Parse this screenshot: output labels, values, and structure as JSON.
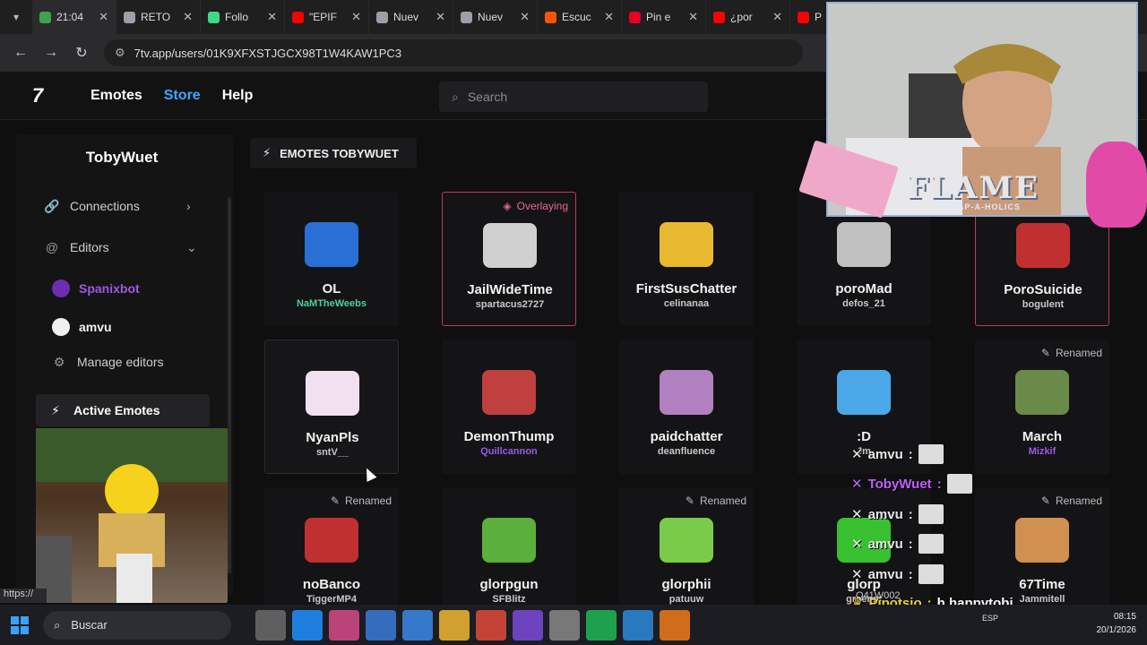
{
  "browser": {
    "tabs": [
      {
        "title": "21:04",
        "color": "#3fa34d"
      },
      {
        "title": "RETO",
        "color": "#9aa0a6"
      },
      {
        "title": "Follo",
        "color": "#3ddc84"
      },
      {
        "title": "\"EPIF",
        "color": "#ff0000"
      },
      {
        "title": "Nuev",
        "color": "#9aa0a6"
      },
      {
        "title": "Nuev",
        "color": "#9aa0a6"
      },
      {
        "title": "Escuc",
        "color": "#ff5500"
      },
      {
        "title": "Pin e",
        "color": "#e60023"
      },
      {
        "title": "¿por",
        "color": "#ff0000"
      },
      {
        "title": "P",
        "color": "#ff0000"
      }
    ],
    "url": "7tv.app/users/01K9XFXSTJGCX98T1W4KAW1PC3",
    "status_url": "https://"
  },
  "header": {
    "logo": "7",
    "nav": {
      "emotes": "Emotes",
      "store": "Store",
      "help": "Help"
    },
    "search_placeholder": "Search"
  },
  "sidebar": {
    "username": "TobyWuet",
    "connections": "Connections",
    "editors": "Editors",
    "editor_list": [
      {
        "name": "Spanixbot",
        "color": "#9b59e8"
      },
      {
        "name": "amvu",
        "color": "#f0f0f0"
      }
    ],
    "manage_editors": "Manage editors",
    "active_emotes": "Active Emotes"
  },
  "section_title": "EMOTES TOBYWUET",
  "emotes": [
    {
      "name": "OL",
      "owner": "NaMTheWeebs",
      "owner_color": "#4fcf9a",
      "badge": ""
    },
    {
      "name": "JailWideTime",
      "owner": "spartacus2727",
      "owner_color": "#c8c8c8",
      "badge": "Overlaying"
    },
    {
      "name": "FirstSusChatter",
      "owner": "celinanaa",
      "owner_color": "#c8c8c8",
      "badge": ""
    },
    {
      "name": "poroMad",
      "owner": "defos_21",
      "owner_color": "#c8c8c8",
      "badge": ""
    },
    {
      "name": "PoroSuicide",
      "owner": "bogulent",
      "owner_color": "#c8c8c8",
      "badge": ""
    },
    {
      "name": "NyanPls",
      "owner": "sntV__",
      "owner_color": "#c8c8c8",
      "badge": ""
    },
    {
      "name": "DemonThump",
      "owner": "Quillcannon",
      "owner_color": "#9b59e8",
      "badge": ""
    },
    {
      "name": "paidchatter",
      "owner": "deanfluence",
      "owner_color": "#c8c8c8",
      "badge": ""
    },
    {
      "name": ":D",
      "owner": "Jm",
      "owner_color": "#c8c8c8",
      "badge": ""
    },
    {
      "name": "March",
      "owner": "Mizkif",
      "owner_color": "#9b59e8",
      "badge": "Renamed"
    },
    {
      "name": "noBanco",
      "owner": "TiggerMP4",
      "owner_color": "#c8c8c8",
      "badge": "Renamed"
    },
    {
      "name": "glorpgun",
      "owner": "SFBlitz",
      "owner_color": "#c8c8c8",
      "badge": ""
    },
    {
      "name": "glorphii",
      "owner": "patuuw",
      "owner_color": "#c8c8c8",
      "badge": "Renamed"
    },
    {
      "name": "glorp",
      "owner": "greenm",
      "owner_color": "#c8c8c8",
      "badge": ""
    },
    {
      "name": "67Time",
      "owner": "Jammitell",
      "owner_color": "#c8c8c8",
      "badge": "Renamed"
    }
  ],
  "chat": [
    {
      "user": "amvu",
      "text": "",
      "color": "#e8e8e8"
    },
    {
      "user": "TobyWuet",
      "text": "",
      "color": "#c060ff"
    },
    {
      "user": "amvu",
      "text": "",
      "color": "#e8e8e8"
    },
    {
      "user": "amvu",
      "text": "",
      "color": "#e8e8e8"
    },
    {
      "user": "amvu",
      "text": "",
      "color": "#e8e8e8"
    },
    {
      "user": "Pipotsio",
      "text": "h happytobi",
      "color": "#f0d040"
    },
    {
      "user": "Pipotsio",
      "text": "happytobi",
      "color": "#f0d040"
    }
  ],
  "overlay": {
    "flame": "FLAME",
    "flame_sub": "TRAP-A-HOLICS",
    "user_code": "Q41W002"
  },
  "taskbar": {
    "search": "Buscar",
    "lang": "ESP",
    "time": "08:15",
    "date": "20/1/2026"
  }
}
